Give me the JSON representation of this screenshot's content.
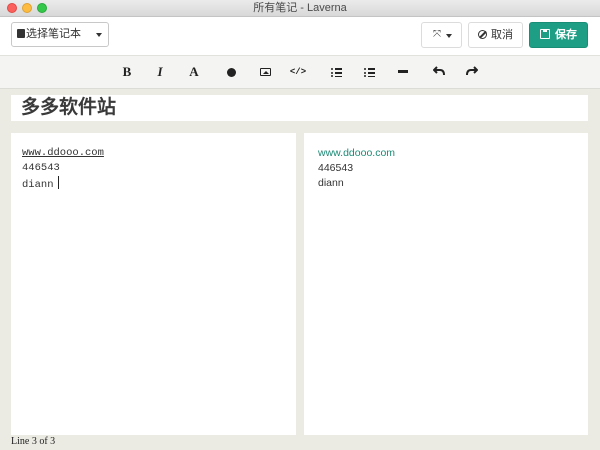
{
  "window": {
    "title": "所有笔记 - Laverna"
  },
  "header": {
    "notebook_select": "选择笔记本",
    "cancel_label": "取消",
    "save_label": "保存",
    "save_color": "#1f9e86"
  },
  "toolbar": {
    "bold": "B",
    "italic": "I",
    "font": "A",
    "code": "</>",
    "tools": [
      "bold-icon",
      "italic-icon",
      "font-icon",
      "globe-icon",
      "picture-icon",
      "code-icon",
      "ordered-list-icon",
      "unordered-list-icon",
      "horizontal-rule-icon",
      "undo-icon",
      "redo-icon"
    ]
  },
  "note": {
    "title": "多多软件站",
    "editor_lines": [
      "www.ddooo.com",
      "446543",
      "diann"
    ],
    "preview_lines": [
      "www.ddooo.com",
      "446543",
      "diann"
    ],
    "link_color": "#1c8a75"
  },
  "status": {
    "text": "Line 3 of 3"
  }
}
